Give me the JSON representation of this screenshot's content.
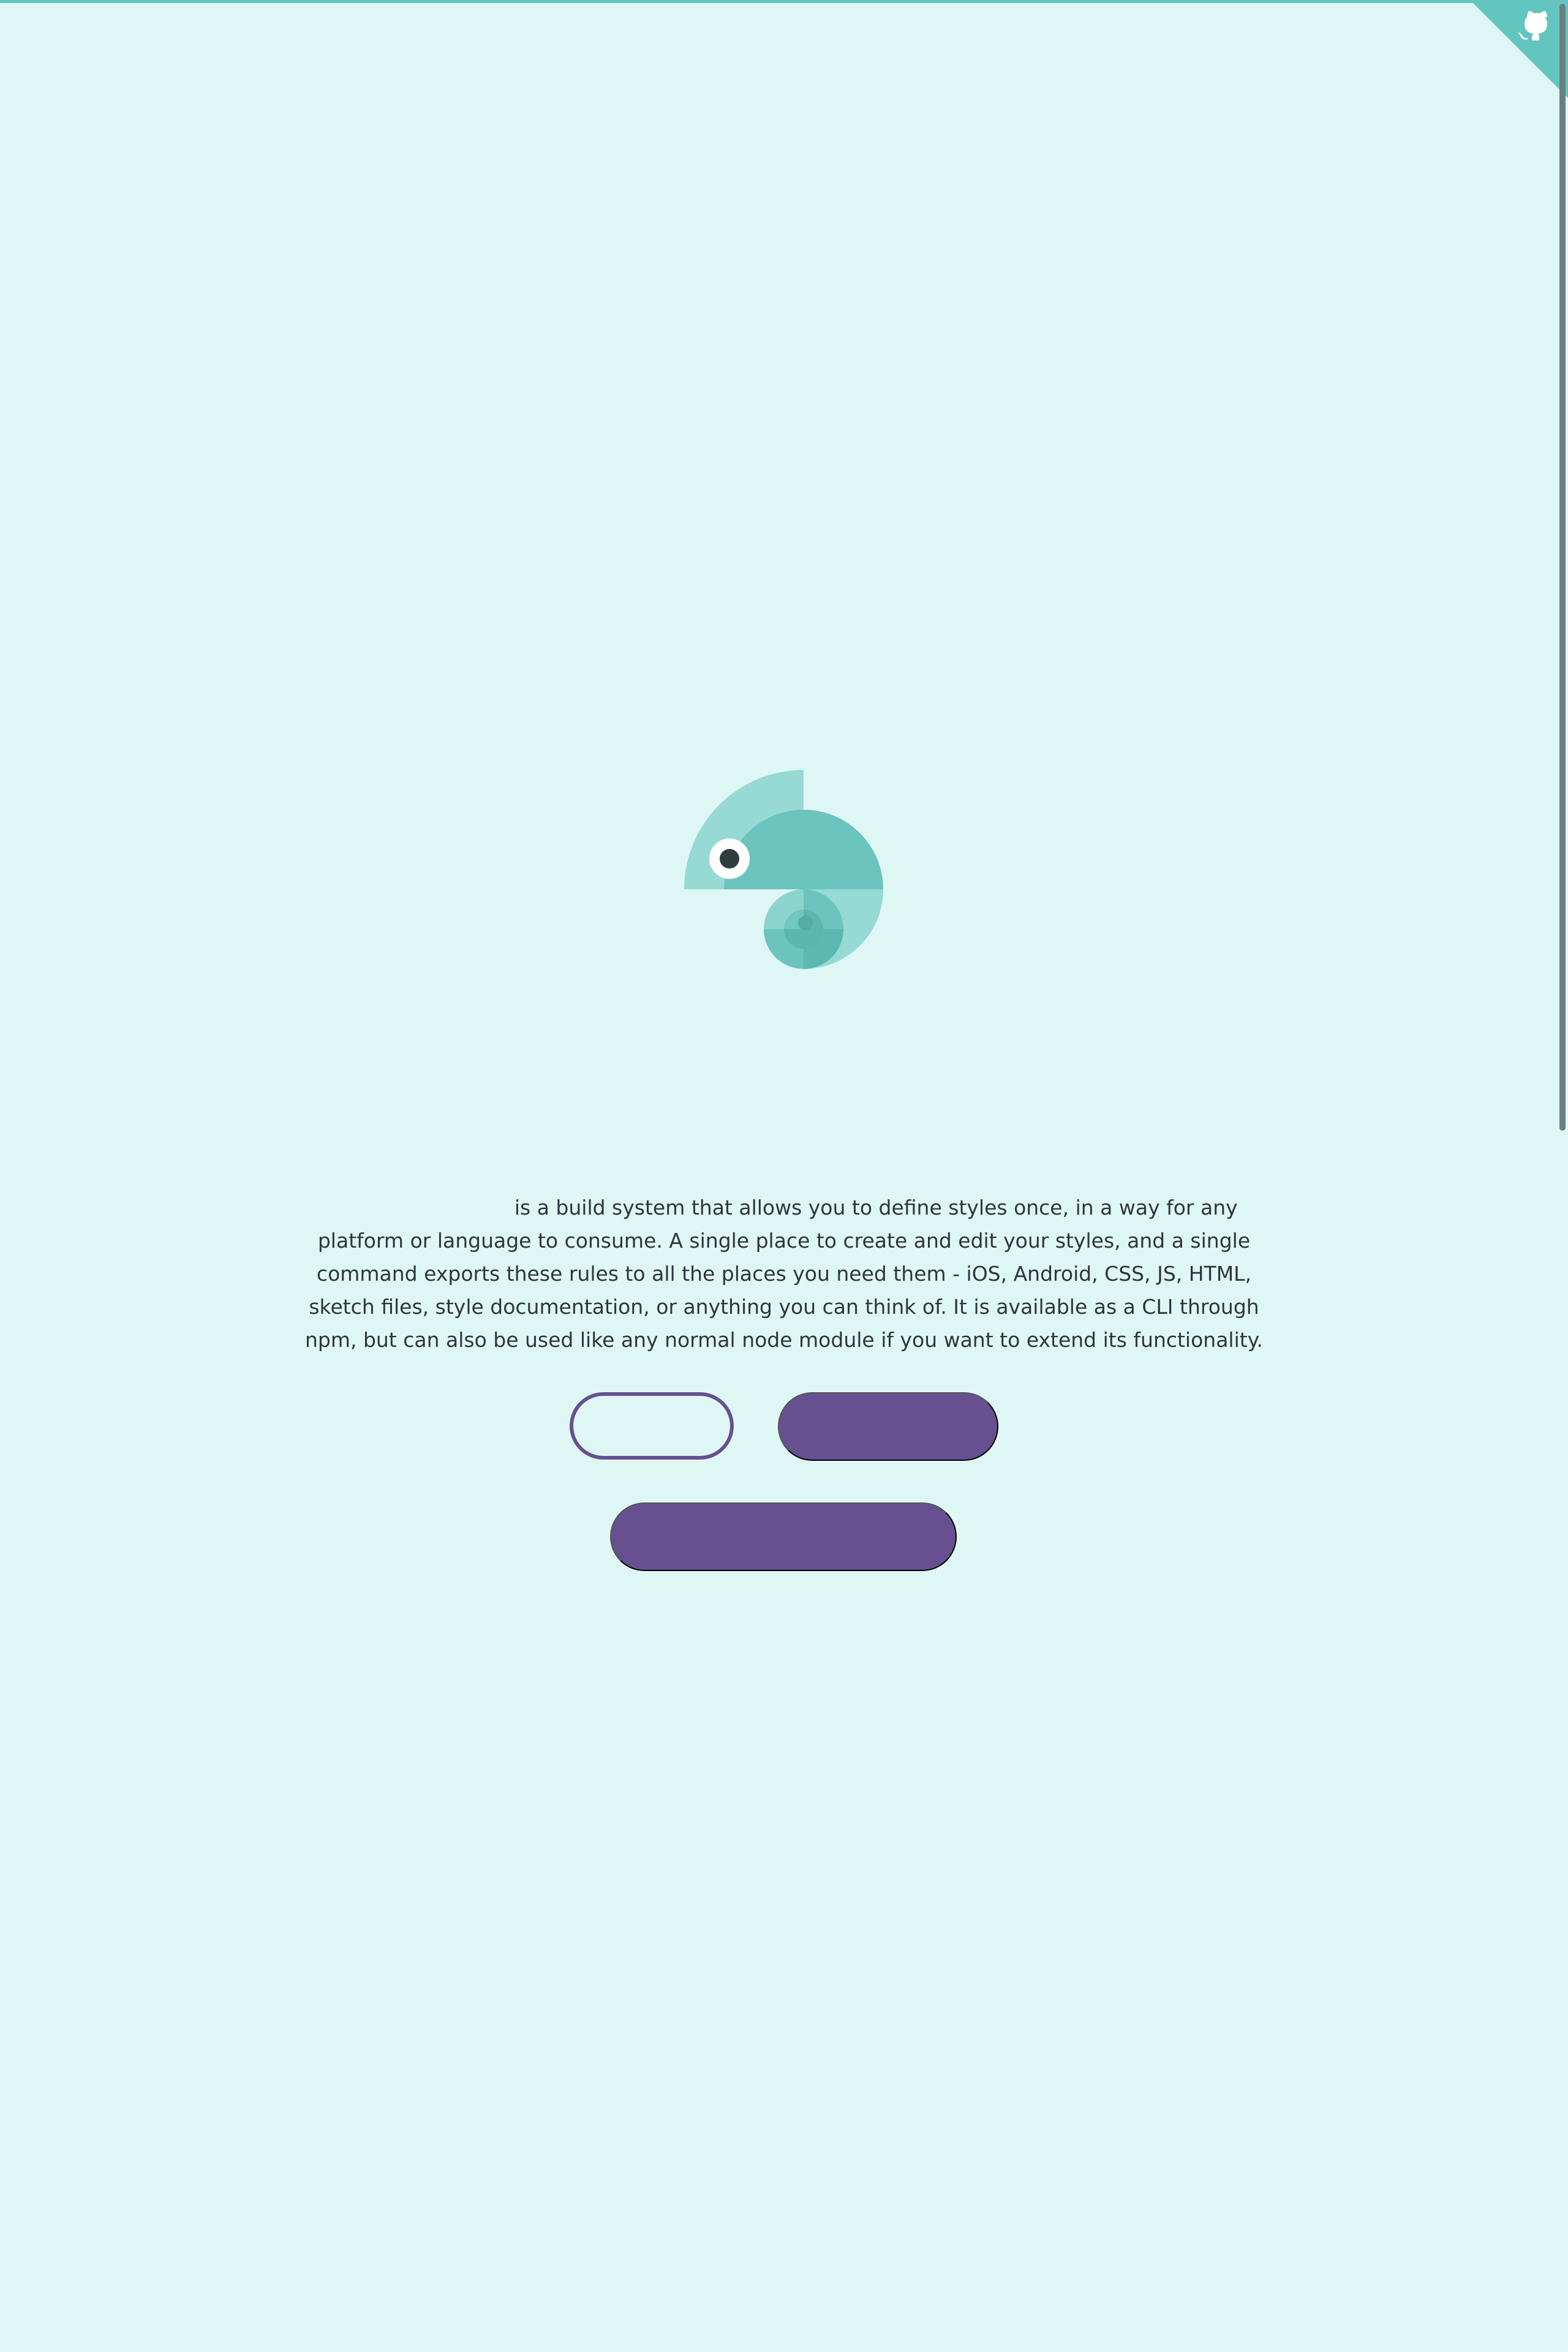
{
  "page": {
    "background_color": "#dff7f4",
    "accent_color": "#63c5bf",
    "button_color": "#66508f"
  },
  "corner": {
    "icon": "github-octocat-icon"
  },
  "logo": {
    "icon": "chameleon-logo-icon"
  },
  "intro": {
    "text": "is a build system that allows you to define styles once, in a way for any platform or language to consume. A single place to create and edit your styles, and a single command exports these rules to all the places you need them - iOS, Android, CSS, JS, HTML, sketch files, style documentation, or anything you can think of. It is available as a CLI through npm, but can also be used like any normal node module if you want to extend its functionality."
  },
  "buttons": {
    "primary_outline_label": "",
    "secondary_label": "",
    "tertiary_label": ""
  }
}
